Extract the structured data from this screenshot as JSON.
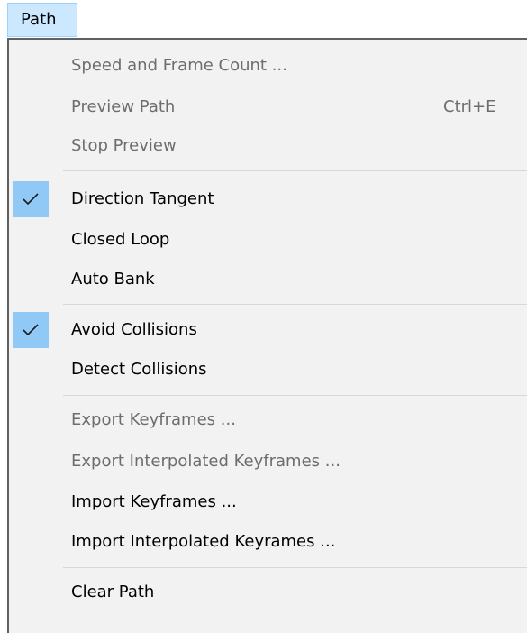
{
  "menubar": {
    "path_label": "Path"
  },
  "menu": {
    "items": [
      {
        "label": "Speed and Frame Count ...",
        "enabled": false,
        "checked": false,
        "shortcut": ""
      },
      {
        "label": "Preview Path",
        "enabled": false,
        "checked": false,
        "shortcut": "Ctrl+E"
      },
      {
        "label": "Stop Preview",
        "enabled": false,
        "checked": false,
        "shortcut": ""
      },
      {
        "label": "Direction Tangent",
        "enabled": true,
        "checked": true,
        "shortcut": ""
      },
      {
        "label": "Closed Loop",
        "enabled": true,
        "checked": false,
        "shortcut": ""
      },
      {
        "label": "Auto Bank",
        "enabled": true,
        "checked": false,
        "shortcut": ""
      },
      {
        "label": "Avoid Collisions",
        "enabled": true,
        "checked": true,
        "shortcut": ""
      },
      {
        "label": "Detect Collisions",
        "enabled": true,
        "checked": false,
        "shortcut": ""
      },
      {
        "label": "Export Keyframes ...",
        "enabled": false,
        "checked": false,
        "shortcut": ""
      },
      {
        "label": "Export Interpolated Keyframes ...",
        "enabled": false,
        "checked": false,
        "shortcut": ""
      },
      {
        "label": "Import Keyframes ...",
        "enabled": true,
        "checked": false,
        "shortcut": ""
      },
      {
        "label": "Import Interpolated Keyrames ...",
        "enabled": true,
        "checked": false,
        "shortcut": ""
      },
      {
        "label": "Clear Path",
        "enabled": true,
        "checked": false,
        "shortcut": ""
      }
    ]
  },
  "icons": {
    "check": "checkmark-icon"
  },
  "colors": {
    "menubar_highlight": "#cce8ff",
    "check_highlight": "#90c8f6",
    "disabled_text": "#6d6d6d",
    "menu_background": "#f2f2f2"
  }
}
